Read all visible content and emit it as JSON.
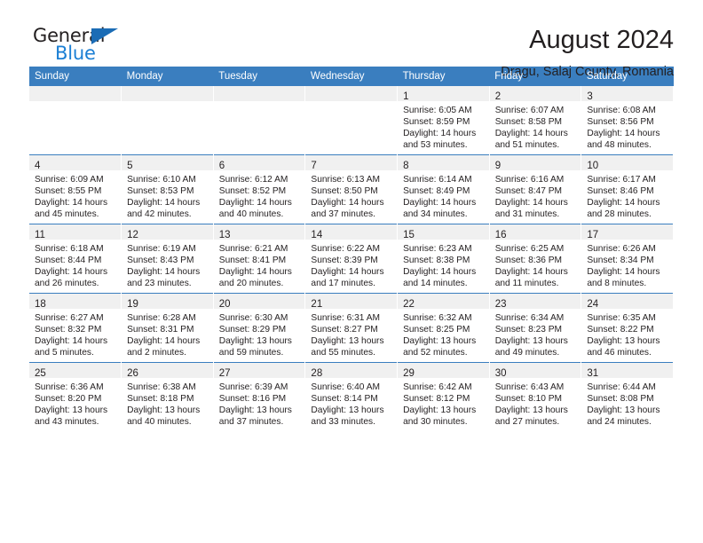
{
  "brand": {
    "name_top": "General",
    "name_bottom": "Blue",
    "accent_color": "#1b7fd4",
    "triangle_color": "#1b6cb5"
  },
  "header": {
    "title": "August 2024",
    "subtitle": "Dragu, Salaj County, Romania"
  },
  "calendar": {
    "header_bg": "#3a7ebf",
    "daynum_bg": "#f0f0f0",
    "weekday_headers": [
      "Sunday",
      "Monday",
      "Tuesday",
      "Wednesday",
      "Thursday",
      "Friday",
      "Saturday"
    ],
    "weeks": [
      [
        {
          "day": "",
          "sunrise": "",
          "sunset": "",
          "daylight_line1": "",
          "daylight_line2": ""
        },
        {
          "day": "",
          "sunrise": "",
          "sunset": "",
          "daylight_line1": "",
          "daylight_line2": ""
        },
        {
          "day": "",
          "sunrise": "",
          "sunset": "",
          "daylight_line1": "",
          "daylight_line2": ""
        },
        {
          "day": "",
          "sunrise": "",
          "sunset": "",
          "daylight_line1": "",
          "daylight_line2": ""
        },
        {
          "day": "1",
          "sunrise": "Sunrise: 6:05 AM",
          "sunset": "Sunset: 8:59 PM",
          "daylight_line1": "Daylight: 14 hours",
          "daylight_line2": "and 53 minutes."
        },
        {
          "day": "2",
          "sunrise": "Sunrise: 6:07 AM",
          "sunset": "Sunset: 8:58 PM",
          "daylight_line1": "Daylight: 14 hours",
          "daylight_line2": "and 51 minutes."
        },
        {
          "day": "3",
          "sunrise": "Sunrise: 6:08 AM",
          "sunset": "Sunset: 8:56 PM",
          "daylight_line1": "Daylight: 14 hours",
          "daylight_line2": "and 48 minutes."
        }
      ],
      [
        {
          "day": "4",
          "sunrise": "Sunrise: 6:09 AM",
          "sunset": "Sunset: 8:55 PM",
          "daylight_line1": "Daylight: 14 hours",
          "daylight_line2": "and 45 minutes."
        },
        {
          "day": "5",
          "sunrise": "Sunrise: 6:10 AM",
          "sunset": "Sunset: 8:53 PM",
          "daylight_line1": "Daylight: 14 hours",
          "daylight_line2": "and 42 minutes."
        },
        {
          "day": "6",
          "sunrise": "Sunrise: 6:12 AM",
          "sunset": "Sunset: 8:52 PM",
          "daylight_line1": "Daylight: 14 hours",
          "daylight_line2": "and 40 minutes."
        },
        {
          "day": "7",
          "sunrise": "Sunrise: 6:13 AM",
          "sunset": "Sunset: 8:50 PM",
          "daylight_line1": "Daylight: 14 hours",
          "daylight_line2": "and 37 minutes."
        },
        {
          "day": "8",
          "sunrise": "Sunrise: 6:14 AM",
          "sunset": "Sunset: 8:49 PM",
          "daylight_line1": "Daylight: 14 hours",
          "daylight_line2": "and 34 minutes."
        },
        {
          "day": "9",
          "sunrise": "Sunrise: 6:16 AM",
          "sunset": "Sunset: 8:47 PM",
          "daylight_line1": "Daylight: 14 hours",
          "daylight_line2": "and 31 minutes."
        },
        {
          "day": "10",
          "sunrise": "Sunrise: 6:17 AM",
          "sunset": "Sunset: 8:46 PM",
          "daylight_line1": "Daylight: 14 hours",
          "daylight_line2": "and 28 minutes."
        }
      ],
      [
        {
          "day": "11",
          "sunrise": "Sunrise: 6:18 AM",
          "sunset": "Sunset: 8:44 PM",
          "daylight_line1": "Daylight: 14 hours",
          "daylight_line2": "and 26 minutes."
        },
        {
          "day": "12",
          "sunrise": "Sunrise: 6:19 AM",
          "sunset": "Sunset: 8:43 PM",
          "daylight_line1": "Daylight: 14 hours",
          "daylight_line2": "and 23 minutes."
        },
        {
          "day": "13",
          "sunrise": "Sunrise: 6:21 AM",
          "sunset": "Sunset: 8:41 PM",
          "daylight_line1": "Daylight: 14 hours",
          "daylight_line2": "and 20 minutes."
        },
        {
          "day": "14",
          "sunrise": "Sunrise: 6:22 AM",
          "sunset": "Sunset: 8:39 PM",
          "daylight_line1": "Daylight: 14 hours",
          "daylight_line2": "and 17 minutes."
        },
        {
          "day": "15",
          "sunrise": "Sunrise: 6:23 AM",
          "sunset": "Sunset: 8:38 PM",
          "daylight_line1": "Daylight: 14 hours",
          "daylight_line2": "and 14 minutes."
        },
        {
          "day": "16",
          "sunrise": "Sunrise: 6:25 AM",
          "sunset": "Sunset: 8:36 PM",
          "daylight_line1": "Daylight: 14 hours",
          "daylight_line2": "and 11 minutes."
        },
        {
          "day": "17",
          "sunrise": "Sunrise: 6:26 AM",
          "sunset": "Sunset: 8:34 PM",
          "daylight_line1": "Daylight: 14 hours",
          "daylight_line2": "and 8 minutes."
        }
      ],
      [
        {
          "day": "18",
          "sunrise": "Sunrise: 6:27 AM",
          "sunset": "Sunset: 8:32 PM",
          "daylight_line1": "Daylight: 14 hours",
          "daylight_line2": "and 5 minutes."
        },
        {
          "day": "19",
          "sunrise": "Sunrise: 6:28 AM",
          "sunset": "Sunset: 8:31 PM",
          "daylight_line1": "Daylight: 14 hours",
          "daylight_line2": "and 2 minutes."
        },
        {
          "day": "20",
          "sunrise": "Sunrise: 6:30 AM",
          "sunset": "Sunset: 8:29 PM",
          "daylight_line1": "Daylight: 13 hours",
          "daylight_line2": "and 59 minutes."
        },
        {
          "day": "21",
          "sunrise": "Sunrise: 6:31 AM",
          "sunset": "Sunset: 8:27 PM",
          "daylight_line1": "Daylight: 13 hours",
          "daylight_line2": "and 55 minutes."
        },
        {
          "day": "22",
          "sunrise": "Sunrise: 6:32 AM",
          "sunset": "Sunset: 8:25 PM",
          "daylight_line1": "Daylight: 13 hours",
          "daylight_line2": "and 52 minutes."
        },
        {
          "day": "23",
          "sunrise": "Sunrise: 6:34 AM",
          "sunset": "Sunset: 8:23 PM",
          "daylight_line1": "Daylight: 13 hours",
          "daylight_line2": "and 49 minutes."
        },
        {
          "day": "24",
          "sunrise": "Sunrise: 6:35 AM",
          "sunset": "Sunset: 8:22 PM",
          "daylight_line1": "Daylight: 13 hours",
          "daylight_line2": "and 46 minutes."
        }
      ],
      [
        {
          "day": "25",
          "sunrise": "Sunrise: 6:36 AM",
          "sunset": "Sunset: 8:20 PM",
          "daylight_line1": "Daylight: 13 hours",
          "daylight_line2": "and 43 minutes."
        },
        {
          "day": "26",
          "sunrise": "Sunrise: 6:38 AM",
          "sunset": "Sunset: 8:18 PM",
          "daylight_line1": "Daylight: 13 hours",
          "daylight_line2": "and 40 minutes."
        },
        {
          "day": "27",
          "sunrise": "Sunrise: 6:39 AM",
          "sunset": "Sunset: 8:16 PM",
          "daylight_line1": "Daylight: 13 hours",
          "daylight_line2": "and 37 minutes."
        },
        {
          "day": "28",
          "sunrise": "Sunrise: 6:40 AM",
          "sunset": "Sunset: 8:14 PM",
          "daylight_line1": "Daylight: 13 hours",
          "daylight_line2": "and 33 minutes."
        },
        {
          "day": "29",
          "sunrise": "Sunrise: 6:42 AM",
          "sunset": "Sunset: 8:12 PM",
          "daylight_line1": "Daylight: 13 hours",
          "daylight_line2": "and 30 minutes."
        },
        {
          "day": "30",
          "sunrise": "Sunrise: 6:43 AM",
          "sunset": "Sunset: 8:10 PM",
          "daylight_line1": "Daylight: 13 hours",
          "daylight_line2": "and 27 minutes."
        },
        {
          "day": "31",
          "sunrise": "Sunrise: 6:44 AM",
          "sunset": "Sunset: 8:08 PM",
          "daylight_line1": "Daylight: 13 hours",
          "daylight_line2": "and 24 minutes."
        }
      ]
    ]
  }
}
